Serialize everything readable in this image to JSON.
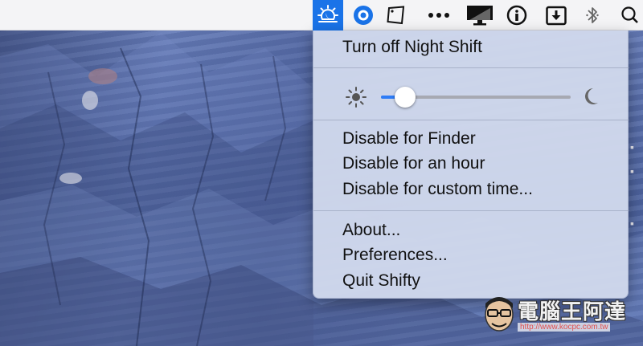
{
  "menubar": {
    "icons": [
      {
        "name": "night-shift-icon",
        "active": true
      },
      {
        "name": "circle-o-icon"
      },
      {
        "name": "rotated-square-icon"
      },
      {
        "name": "ellipsis-icon"
      },
      {
        "name": "display-icon"
      },
      {
        "name": "info-circle-icon"
      },
      {
        "name": "download-box-icon"
      },
      {
        "name": "bluetooth-icon"
      },
      {
        "name": "search-icon"
      }
    ],
    "active_color": "#1a73e8"
  },
  "menu": {
    "toggle_label": "Turn off Night Shift",
    "slider": {
      "value": 0.08,
      "left_icon": "sun-icon",
      "right_icon": "moon-icon",
      "fill_color": "#2e7cf6"
    },
    "disable_items": [
      "Disable for Finder",
      "Disable for an hour",
      "Disable for custom time..."
    ],
    "app_items": [
      "About...",
      "Preferences...",
      "Quit Shifty"
    ]
  },
  "watermark": {
    "title": "電腦王阿達",
    "url": "http://www.kocpc.com.tw"
  }
}
